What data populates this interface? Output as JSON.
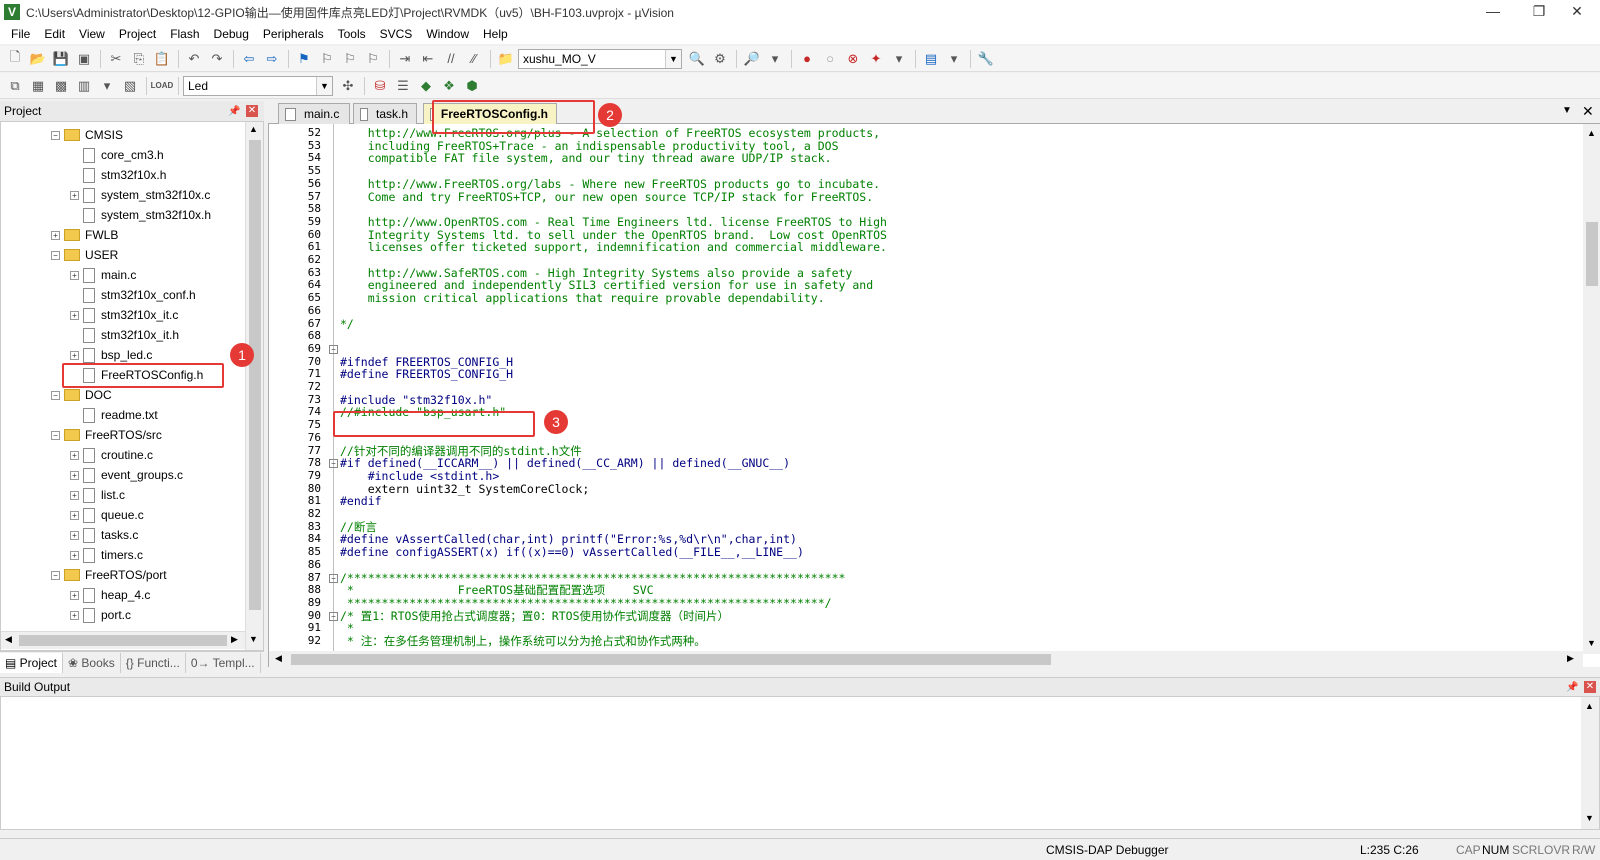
{
  "window": {
    "title": "C:\\Users\\Administrator\\Desktop\\12-GPIO输出—使用固件库点亮LED灯\\Project\\RVMDK（uv5）\\BH-F103.uvprojx - µVision",
    "app_icon": "V",
    "controls": [
      "—",
      "❐",
      "✕"
    ]
  },
  "menu": [
    "File",
    "Edit",
    "View",
    "Project",
    "Flash",
    "Debug",
    "Peripherals",
    "Tools",
    "SVCS",
    "Window",
    "Help"
  ],
  "toolbar": {
    "find_combo": "xushu_MO_V",
    "target_combo": "Led",
    "load_label": "LOAD"
  },
  "project_panel": {
    "title": "Project",
    "tree": [
      {
        "label": "CMSIS",
        "type": "folder",
        "level": 1,
        "state": "−"
      },
      {
        "label": "core_cm3.h",
        "type": "file",
        "level": 2,
        "state": ""
      },
      {
        "label": "stm32f10x.h",
        "type": "file",
        "level": 2,
        "state": ""
      },
      {
        "label": "system_stm32f10x.c",
        "type": "file",
        "level": 2,
        "state": "+"
      },
      {
        "label": "system_stm32f10x.h",
        "type": "file",
        "level": 2,
        "state": ""
      },
      {
        "label": "FWLB",
        "type": "folder",
        "level": 1,
        "state": "+"
      },
      {
        "label": "USER",
        "type": "folder",
        "level": 1,
        "state": "−"
      },
      {
        "label": "main.c",
        "type": "file",
        "level": 2,
        "state": "+"
      },
      {
        "label": "stm32f10x_conf.h",
        "type": "file",
        "level": 2,
        "state": ""
      },
      {
        "label": "stm32f10x_it.c",
        "type": "file",
        "level": 2,
        "state": "+"
      },
      {
        "label": "stm32f10x_it.h",
        "type": "file",
        "level": 2,
        "state": ""
      },
      {
        "label": "bsp_led.c",
        "type": "file",
        "level": 2,
        "state": "+"
      },
      {
        "label": "FreeRTOSConfig.h",
        "type": "file",
        "level": 2,
        "state": ""
      },
      {
        "label": "DOC",
        "type": "folder",
        "level": 1,
        "state": "−"
      },
      {
        "label": "readme.txt",
        "type": "file",
        "level": 2,
        "state": ""
      },
      {
        "label": "FreeRTOS/src",
        "type": "folder",
        "level": 1,
        "state": "−"
      },
      {
        "label": "croutine.c",
        "type": "file",
        "level": 2,
        "state": "+"
      },
      {
        "label": "event_groups.c",
        "type": "file",
        "level": 2,
        "state": "+"
      },
      {
        "label": "list.c",
        "type": "file",
        "level": 2,
        "state": "+"
      },
      {
        "label": "queue.c",
        "type": "file",
        "level": 2,
        "state": "+"
      },
      {
        "label": "tasks.c",
        "type": "file",
        "level": 2,
        "state": "+"
      },
      {
        "label": "timers.c",
        "type": "file",
        "level": 2,
        "state": "+"
      },
      {
        "label": "FreeRTOS/port",
        "type": "folder",
        "level": 1,
        "state": "−"
      },
      {
        "label": "heap_4.c",
        "type": "file",
        "level": 2,
        "state": "+"
      },
      {
        "label": "port.c",
        "type": "file",
        "level": 2,
        "state": "+"
      }
    ],
    "tabs": [
      "Project",
      "Books",
      "{} Functi...",
      "0→ Templ..."
    ]
  },
  "editor": {
    "tabs": [
      "main.c",
      "task.h",
      "FreeRTOSConfig.h"
    ],
    "active_tab": "FreeRTOSConfig.h",
    "lines": [
      {
        "n": "52",
        "t": "    http://www.FreeRTOS.org/plus - A selection of FreeRTOS ecosystem products,",
        "c": "code"
      },
      {
        "n": "53",
        "t": "    including FreeRTOS+Trace - an indispensable productivity tool, a DOS",
        "c": "code"
      },
      {
        "n": "54",
        "t": "    compatible FAT file system, and our tiny thread aware UDP/IP stack.",
        "c": "code"
      },
      {
        "n": "55",
        "t": "",
        "c": "code"
      },
      {
        "n": "56",
        "t": "    http://www.FreeRTOS.org/labs - Where new FreeRTOS products go to incubate.",
        "c": "code"
      },
      {
        "n": "57",
        "t": "    Come and try FreeRTOS+TCP, our new open source TCP/IP stack for FreeRTOS.",
        "c": "code"
      },
      {
        "n": "58",
        "t": "",
        "c": "code"
      },
      {
        "n": "59",
        "t": "    http://www.OpenRTOS.com - Real Time Engineers ltd. license FreeRTOS to High",
        "c": "code"
      },
      {
        "n": "60",
        "t": "    Integrity Systems ltd. to sell under the OpenRTOS brand.  Low cost OpenRTOS",
        "c": "code"
      },
      {
        "n": "61",
        "t": "    licenses offer ticketed support, indemnification and commercial middleware.",
        "c": "code"
      },
      {
        "n": "62",
        "t": "",
        "c": "code"
      },
      {
        "n": "63",
        "t": "    http://www.SafeRTOS.com - High Integrity Systems also provide a safety",
        "c": "code"
      },
      {
        "n": "64",
        "t": "    engineered and independently SIL3 certified version for use in safety and",
        "c": "code"
      },
      {
        "n": "65",
        "t": "    mission critical applications that require provable dependability.",
        "c": "code"
      },
      {
        "n": "66",
        "t": "",
        "c": "code"
      },
      {
        "n": "67",
        "t": "*/",
        "c": "code"
      },
      {
        "n": "68",
        "t": "",
        "c": "code"
      },
      {
        "n": "69",
        "t": "",
        "c": "code"
      },
      {
        "n": "70",
        "t": "#ifndef FREERTOS_CONFIG_H",
        "c": "code pp"
      },
      {
        "n": "71",
        "t": "#define FREERTOS_CONFIG_H",
        "c": "code pp"
      },
      {
        "n": "72",
        "t": "",
        "c": "code"
      },
      {
        "n": "73",
        "t": "#include \"stm32f10x.h\"",
        "c": "code pp"
      },
      {
        "n": "74",
        "t": "//#include \"bsp_usart.h\"",
        "c": "code"
      },
      {
        "n": "75",
        "t": "",
        "c": "code"
      },
      {
        "n": "76",
        "t": "",
        "c": "code"
      },
      {
        "n": "77",
        "t": "//针对不同的编译器调用不同的stdint.h文件",
        "c": "code"
      },
      {
        "n": "78",
        "t": "#if defined(__ICCARM__) || defined(__CC_ARM) || defined(__GNUC__)",
        "c": "code pp"
      },
      {
        "n": "79",
        "t": "    #include <stdint.h>",
        "c": "code pp"
      },
      {
        "n": "80",
        "t": "    extern uint32_t SystemCoreClock;",
        "c": "code dark"
      },
      {
        "n": "81",
        "t": "#endif",
        "c": "code pp"
      },
      {
        "n": "82",
        "t": "",
        "c": "code"
      },
      {
        "n": "83",
        "t": "//断言",
        "c": "code"
      },
      {
        "n": "84",
        "t": "#define vAssertCalled(char,int) printf(\"Error:%s,%d\\r\\n\",char,int)",
        "c": "code pp"
      },
      {
        "n": "85",
        "t": "#define configASSERT(x) if((x)==0) vAssertCalled(__FILE__,__LINE__)",
        "c": "code pp"
      },
      {
        "n": "86",
        "t": "",
        "c": "code"
      },
      {
        "n": "87",
        "t": "/************************************************************************",
        "c": "code"
      },
      {
        "n": "88",
        "t": " *               FreeRTOS基础配置配置选项    SVC",
        "c": "code"
      },
      {
        "n": "89",
        "t": " *********************************************************************/",
        "c": "code"
      },
      {
        "n": "90",
        "t": "/* 置1：RTOS使用抢占式调度器；置0：RTOS使用协作式调度器（时间片）",
        "c": "code"
      },
      {
        "n": "91",
        "t": " *",
        "c": "code"
      },
      {
        "n": "92",
        "t": " * 注：在多任务管理机制上，操作系统可以分为抢占式和协作式两种。",
        "c": "code"
      }
    ]
  },
  "build_output": {
    "title": "Build Output"
  },
  "statusbar": {
    "debugger": "CMSIS-DAP Debugger",
    "position": "L:235 C:26",
    "cap": "CAP",
    "num": "NUM",
    "scrl": "SCRL",
    "ovr": "OVR",
    "rw": "R/W"
  },
  "annotations": [
    "1",
    "2",
    "3"
  ],
  "colors": {
    "annotation": "#e53935",
    "comment": "#008000",
    "preprocessor": "#000080",
    "active_tab": "#f7f3c4"
  }
}
